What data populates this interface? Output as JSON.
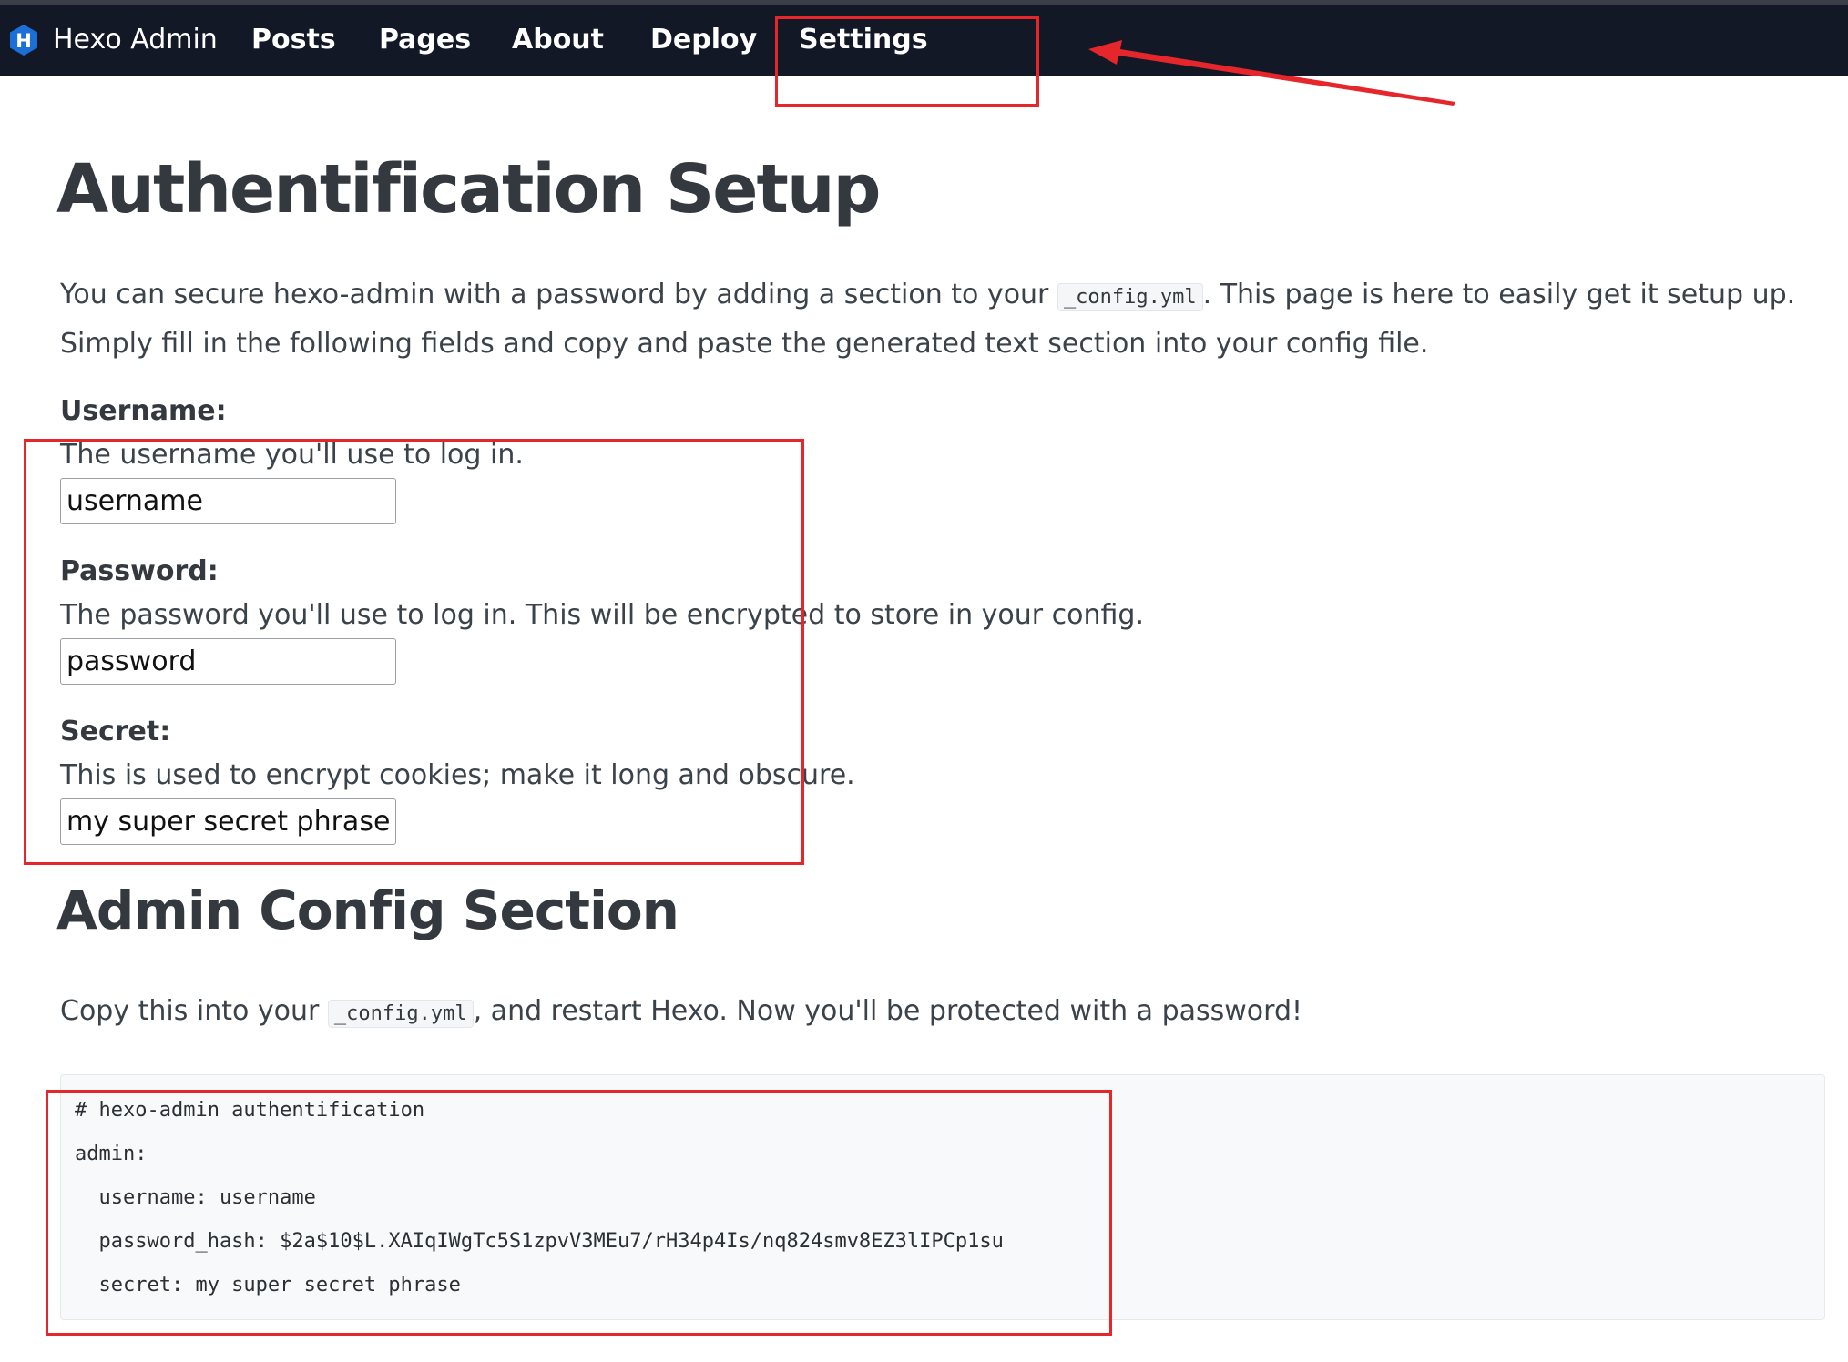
{
  "navbar": {
    "brand_icon_letter": "H",
    "brand_label": "Hexo Admin",
    "items": [
      {
        "label": "Posts"
      },
      {
        "label": "Pages"
      },
      {
        "label": "About"
      },
      {
        "label": "Deploy"
      },
      {
        "label": "Settings"
      }
    ]
  },
  "auth": {
    "title": "Authentification Setup",
    "intro_before": "You can secure hexo-admin with a password by adding a section to your ",
    "intro_code": "_config.yml",
    "intro_after": ". This page is here to easily get it setup up. Simply fill in the following fields and copy and paste the generated text section into your config file.",
    "username": {
      "label": "Username:",
      "help": "The username you'll use to log in.",
      "value": "username"
    },
    "password": {
      "label": "Password:",
      "help": "The password you'll use to log in. This will be encrypted to store in your config.",
      "value": "password"
    },
    "secret": {
      "label": "Secret:",
      "help": "This is used to encrypt cookies; make it long and obscure.",
      "value": "my super secret phrase"
    }
  },
  "config_section": {
    "title": "Admin Config Section",
    "desc_before": "Copy this into your ",
    "desc_code": "_config.yml",
    "desc_after": ", and restart Hexo. Now you'll be protected with a password!",
    "code_lines": [
      "# hexo-admin authentification",
      "admin:",
      "  username: username",
      "  password_hash: $2a$10$L.XAIqIWgTc5S1zpvV3MEu7/rH34p4Is/nq824smv8EZ3lIPCp1su",
      "  secret: my super secret phrase"
    ]
  },
  "colors": {
    "navbar_bg": "#121826",
    "brand_icon": "#1b6fd6",
    "annotation": "#e5262a",
    "code_bg": "#f7f9fa"
  }
}
